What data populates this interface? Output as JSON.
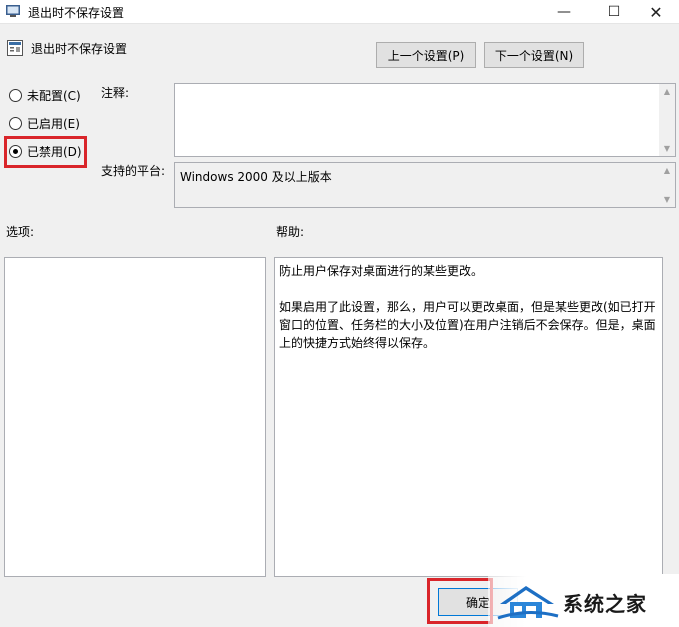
{
  "window": {
    "title": "退出时不保存设置",
    "controls": {
      "minimize": "—",
      "maximize": "☐",
      "close": "✕"
    }
  },
  "header": {
    "policy_name": "退出时不保存设置",
    "prev_button": "上一个设置(P)",
    "next_button": "下一个设置(N)"
  },
  "state_options": [
    {
      "label": "未配置(C)",
      "selected": false
    },
    {
      "label": "已启用(E)",
      "selected": false
    },
    {
      "label": "已禁用(D)",
      "selected": true
    }
  ],
  "comment": {
    "label": "注释:",
    "value": ""
  },
  "supported_on": {
    "label": "支持的平台:",
    "value": "Windows 2000 及以上版本"
  },
  "options": {
    "label": "选项:"
  },
  "help": {
    "label": "帮助:",
    "paragraphs": [
      "防止用户保存对桌面进行的某些更改。",
      "如果启用了此设置，那么，用户可以更改桌面，但是某些更改(如已打开窗口的位置、任务栏的大小及位置)在用户注销后不会保存。但是，桌面上的快捷方式始终得以保存。"
    ]
  },
  "footer": {
    "ok_button": "确定"
  },
  "watermark": {
    "text": "系统之家"
  },
  "colors": {
    "highlight": "#d9252a",
    "accent": "#0078d7"
  }
}
